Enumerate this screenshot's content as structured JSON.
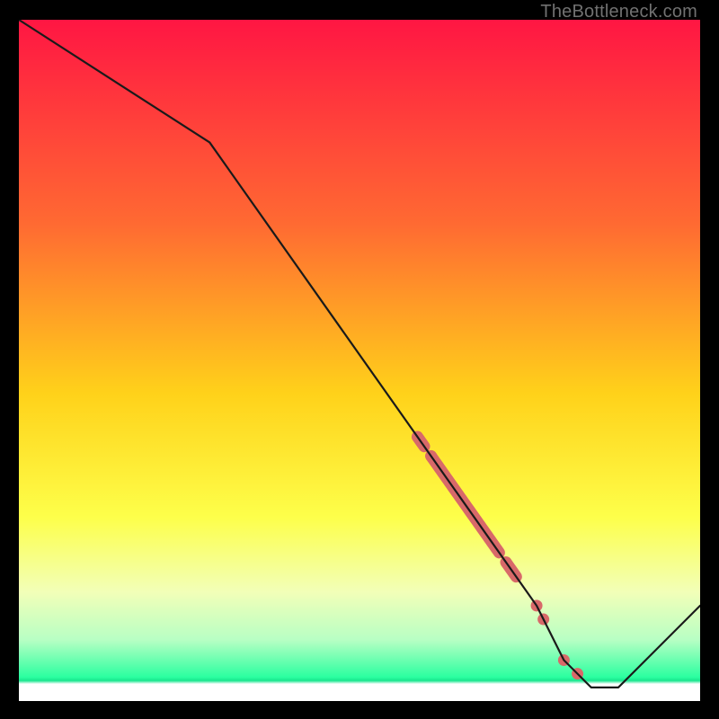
{
  "watermark": "TheBottleneck.com",
  "chart_data": {
    "type": "line",
    "title": "",
    "xlabel": "",
    "ylabel": "",
    "xlim": [
      0,
      100
    ],
    "ylim": [
      0,
      100
    ],
    "x": [
      0,
      28,
      76,
      80,
      84,
      88,
      100
    ],
    "values": [
      100,
      82,
      14,
      6,
      2,
      2,
      14
    ],
    "highlight_x_range": [
      59,
      82
    ],
    "highlight_points_x": [
      59,
      62,
      63,
      66,
      68,
      72,
      76,
      77,
      80,
      82
    ],
    "highlight_precise": {
      "thick_segments": [
        {
          "x0": 58.5,
          "x1": 59.5
        },
        {
          "x0": 60.5,
          "x1": 70.5
        },
        {
          "x0": 71.5,
          "x1": 73.0
        }
      ],
      "dots": [
        60.5,
        76.0,
        77.0,
        80.0,
        82.0
      ]
    },
    "gradient_stops": [
      {
        "pct": 0,
        "color": "#ff1643"
      },
      {
        "pct": 30,
        "color": "#ff6a32"
      },
      {
        "pct": 55,
        "color": "#ffd21a"
      },
      {
        "pct": 73,
        "color": "#fdff4a"
      },
      {
        "pct": 84,
        "color": "#f2ffb8"
      },
      {
        "pct": 91,
        "color": "#b8ffc4"
      },
      {
        "pct": 96.5,
        "color": "#2bffa0"
      },
      {
        "pct": 97.0,
        "color": "#18e68e"
      },
      {
        "pct": 97.5,
        "color": "#ffffff"
      },
      {
        "pct": 100,
        "color": "#ffffff"
      }
    ],
    "highlight_color": "#d86969",
    "line_color": "#1a1a1a"
  }
}
